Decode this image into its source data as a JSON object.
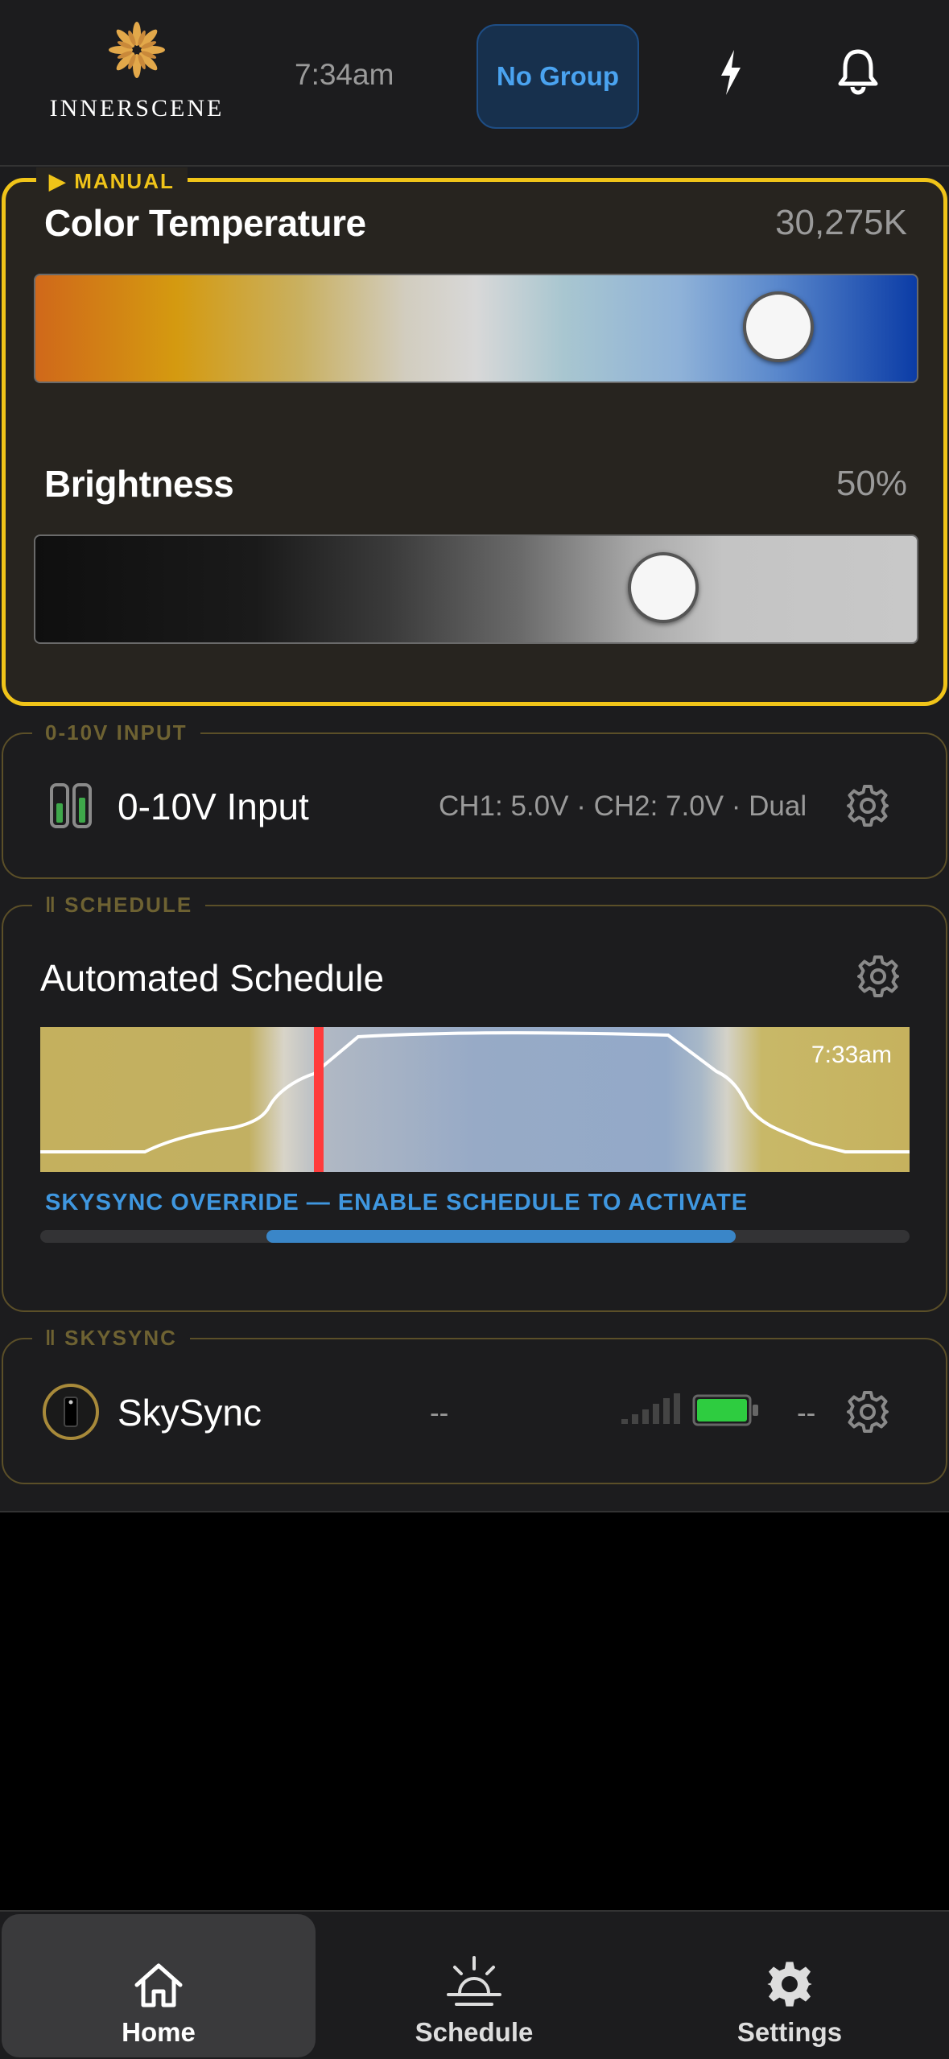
{
  "header": {
    "logo_text": "INNERSCENE",
    "time": "7:34am",
    "group_button": "No Group",
    "icons": [
      "bolt-icon",
      "bell-icon"
    ]
  },
  "manual": {
    "tag": "MANUAL",
    "color_temperature": {
      "label": "Color Temperature",
      "value": "30,275K",
      "position": 0.84
    },
    "brightness": {
      "label": "Brightness",
      "value": "50%",
      "position": 0.71
    },
    "accent_color": "#f0c419"
  },
  "input_section": {
    "tag": "0-10V INPUT",
    "title": "0-10V Input",
    "status": "CH1: 5.0V · CH2: 7.0V · Dual"
  },
  "schedule": {
    "tag": "SCHEDULE",
    "title": "Automated Schedule",
    "chart_time": "7:33am",
    "override_text": "SKYSYNC OVERRIDE — ENABLE SCHEDULE TO ACTIVATE",
    "progress": {
      "start": 0.26,
      "end": 0.8
    }
  },
  "skysync": {
    "tag": "SKYSYNC",
    "title": "SkySync",
    "value1": "--",
    "value2": "--",
    "battery_color": "#2ecc40"
  },
  "nav": {
    "home": "Home",
    "schedule": "Schedule",
    "settings": "Settings",
    "active": "home"
  }
}
